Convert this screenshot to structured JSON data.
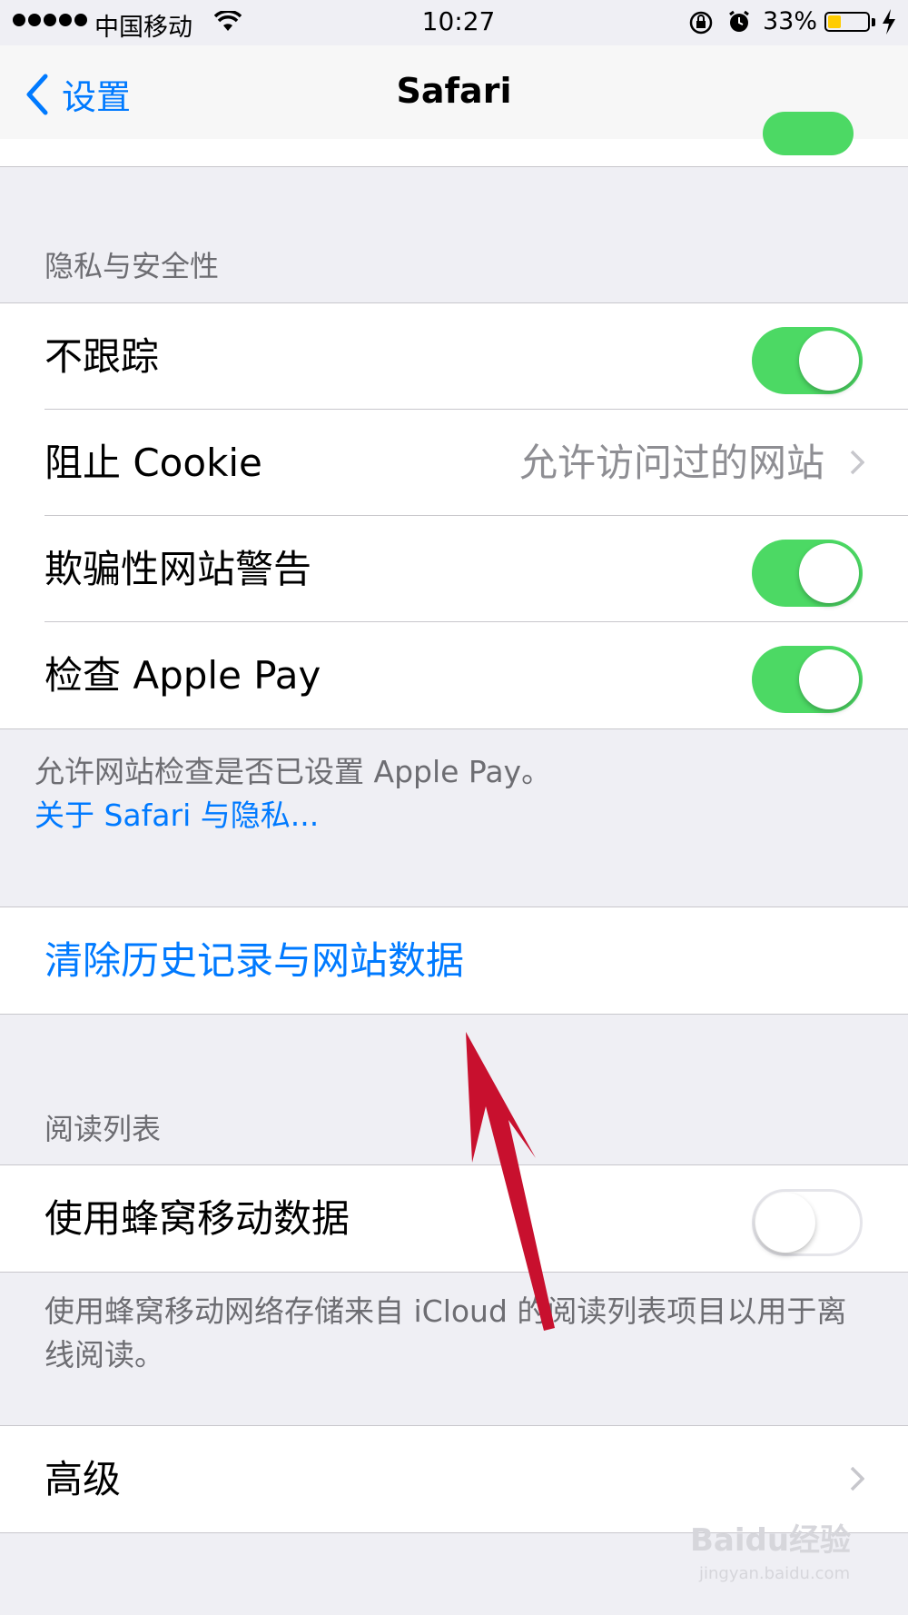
{
  "status_bar": {
    "carrier": "中国移动",
    "time": "10:27",
    "battery_percent": "33%",
    "battery_level": 0.33,
    "battery_color": "#ffcc00"
  },
  "nav": {
    "back_label": "设置",
    "title": "Safari"
  },
  "privacy": {
    "header": "隐私与安全性",
    "items": [
      {
        "label": "不跟踪",
        "toggle": true
      },
      {
        "label": "阻止 Cookie",
        "value": "允许访问过的网站"
      },
      {
        "label": "欺骗性网站警告",
        "toggle": true
      },
      {
        "label": "检查 Apple Pay",
        "toggle": true
      }
    ],
    "footer": "允许网站检查是否已设置 Apple Pay。",
    "footer_link": "关于 Safari 与隐私..."
  },
  "clear_history": {
    "label": "清除历史记录与网站数据"
  },
  "reading_list": {
    "header": "阅读列表",
    "items": [
      {
        "label": "使用蜂窝移动数据",
        "toggle": false
      }
    ],
    "footer": "使用蜂窝移动网络存储来自 iCloud 的阅读列表项目以用于离线阅读。"
  },
  "advanced": {
    "label": "高级"
  },
  "watermark": {
    "brand": "Baidu经验",
    "url": "jingyan.baidu.com"
  },
  "colors": {
    "accent": "#007aff",
    "toggle_on": "#4cd964",
    "annotation_arrow": "#c8102e"
  }
}
